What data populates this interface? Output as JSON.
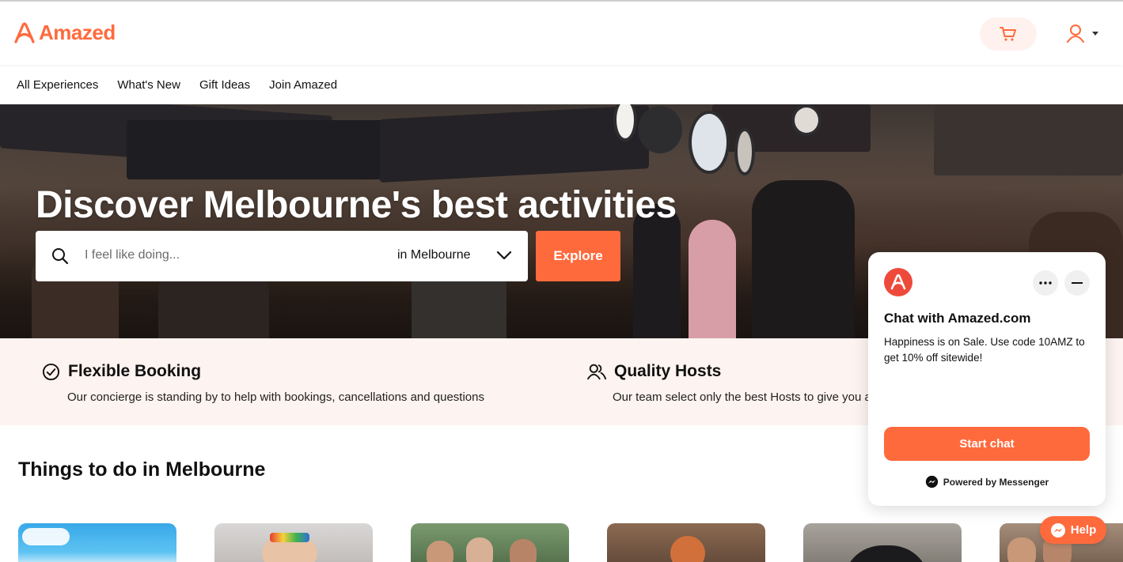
{
  "brand": {
    "name": "Amazed",
    "accent": "#ff6a3d"
  },
  "header": {
    "cart_icon": "cart-icon",
    "user_icon": "user-icon"
  },
  "nav": {
    "items": [
      {
        "label": "All Experiences"
      },
      {
        "label": "What's New"
      },
      {
        "label": "Gift Ideas"
      },
      {
        "label": "Join Amazed"
      }
    ]
  },
  "hero": {
    "title": "Discover Melbourne's best activities",
    "search": {
      "placeholder": "I feel like doing...",
      "location": "in Melbourne"
    },
    "explore_label": "Explore"
  },
  "features": [
    {
      "title": "Flexible Booking",
      "desc": "Our concierge is standing by to help with bookings, cancellations and questions",
      "icon": "check-circle-icon"
    },
    {
      "title": "Quality Hosts",
      "desc": "Our team select only the best Hosts to give you a v",
      "icon": "users-icon"
    }
  ],
  "section": {
    "title": "Things to do in Melbourne"
  },
  "chat": {
    "title": "Chat with Amazed.com",
    "message": "Happiness is on Sale. Use code 10AMZ to get 10% off sitewide!",
    "start_label": "Start chat",
    "powered_by": "Powered by Messenger"
  },
  "help": {
    "label": "Help"
  }
}
